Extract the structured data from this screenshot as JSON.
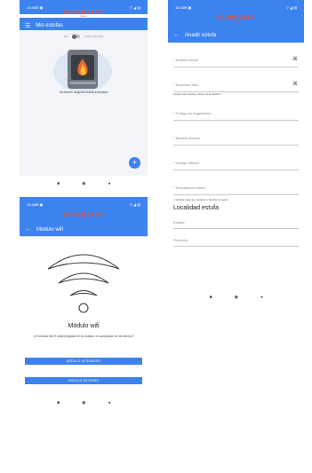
{
  "status": {
    "time": "10:46",
    "icons_left": "✉ ▣",
    "icons_right": "▽ ◢ ▤"
  },
  "logo": {
    "main": "ECOFOREST",
    "sub": "stoves"
  },
  "screen1": {
    "title": "Mis estufas",
    "toggle_left": "ON",
    "toggle_right": "SOLO ESTUFA",
    "empty_message": "No tienes ninguna estufa insertada",
    "fab": "+"
  },
  "screen2": {
    "title": "Anadir estufa",
    "fields": {
      "serial": "* Numero serial",
      "mac": "* Direccion MAC",
      "mac_hint": "Inserte i solo numeros y letras, sin el caracter \":\"",
      "registration": "* Codigo de registracion",
      "model": "* Modelo articulo",
      "code": "* Codigo articulo",
      "description": "* Descripcion estufa",
      "check": "Estufa casa de montana' o 'Estufa comedor'"
    },
    "section": "Localidad estufa",
    "location": {
      "state": "Estado",
      "province": "Provincia"
    }
  },
  "screen3": {
    "title": "Modulo wifi",
    "heading": "Módulo wifi",
    "question": "¿El módulo Wi-Fi está integrado en tu estufa o lo compraste en kit externo?",
    "btn_integrated": "MÓDULO INTEGRADO",
    "btn_external": "MÓDULO EXTERNO"
  },
  "nav": {
    "square": "■",
    "circle": "◉",
    "back": "◂"
  },
  "colors": {
    "primary": "#3d83f0",
    "logo": "#e2543c",
    "flame": "#f06a2a"
  }
}
